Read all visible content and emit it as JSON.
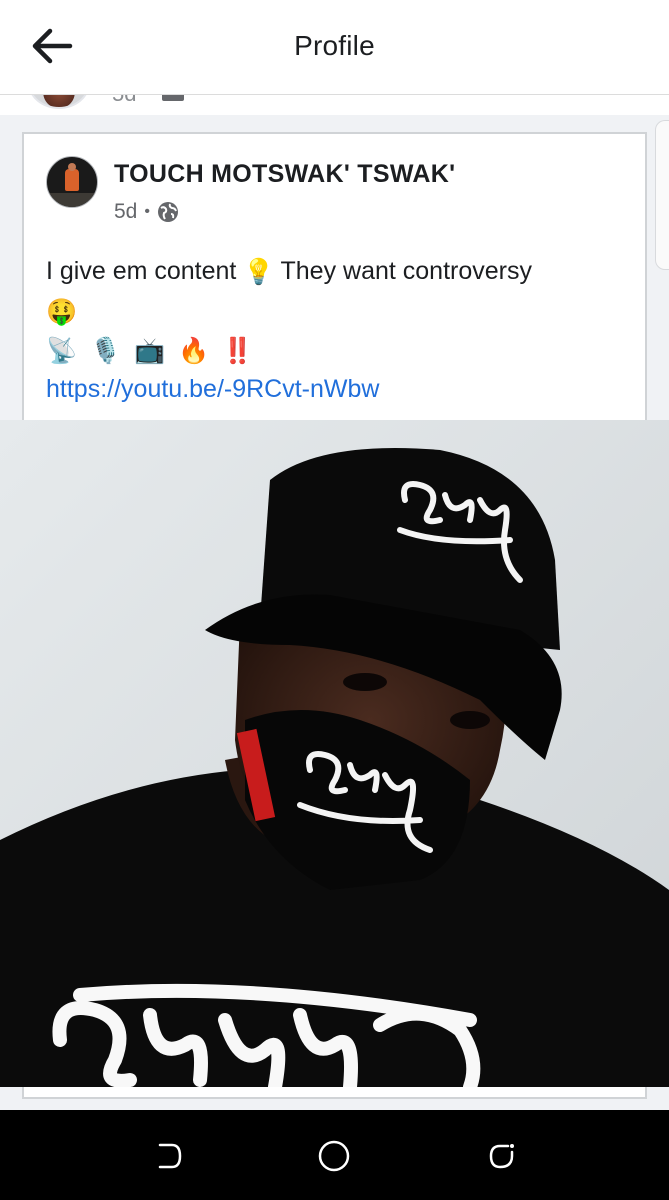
{
  "header": {
    "title": "Profile",
    "back_icon": "arrow-left-icon"
  },
  "previous_post": {
    "time": "5d"
  },
  "post": {
    "author": "TOUCH MOTSWAK' TSWAK'",
    "time": "5d",
    "separator": "•",
    "privacy_icon": "globe-icon",
    "text_before_emoji": "I give em content",
    "text_after_emoji": "They want controversy",
    "emojis_line1": [
      "💡",
      "🤑"
    ],
    "emojis_line2": [
      "📡",
      "🎙️",
      "📺",
      "🔥",
      "‼️"
    ],
    "link": "https://youtu.be/-9RCvt-nWbw"
  },
  "nav": {
    "items": [
      {
        "icon": "recent-apps-icon"
      },
      {
        "icon": "home-icon"
      },
      {
        "icon": "back-icon"
      }
    ]
  },
  "colors": {
    "link": "#216fdb",
    "text": "#1c1e21",
    "meta": "#65676b",
    "background": "#f0f2f5"
  }
}
